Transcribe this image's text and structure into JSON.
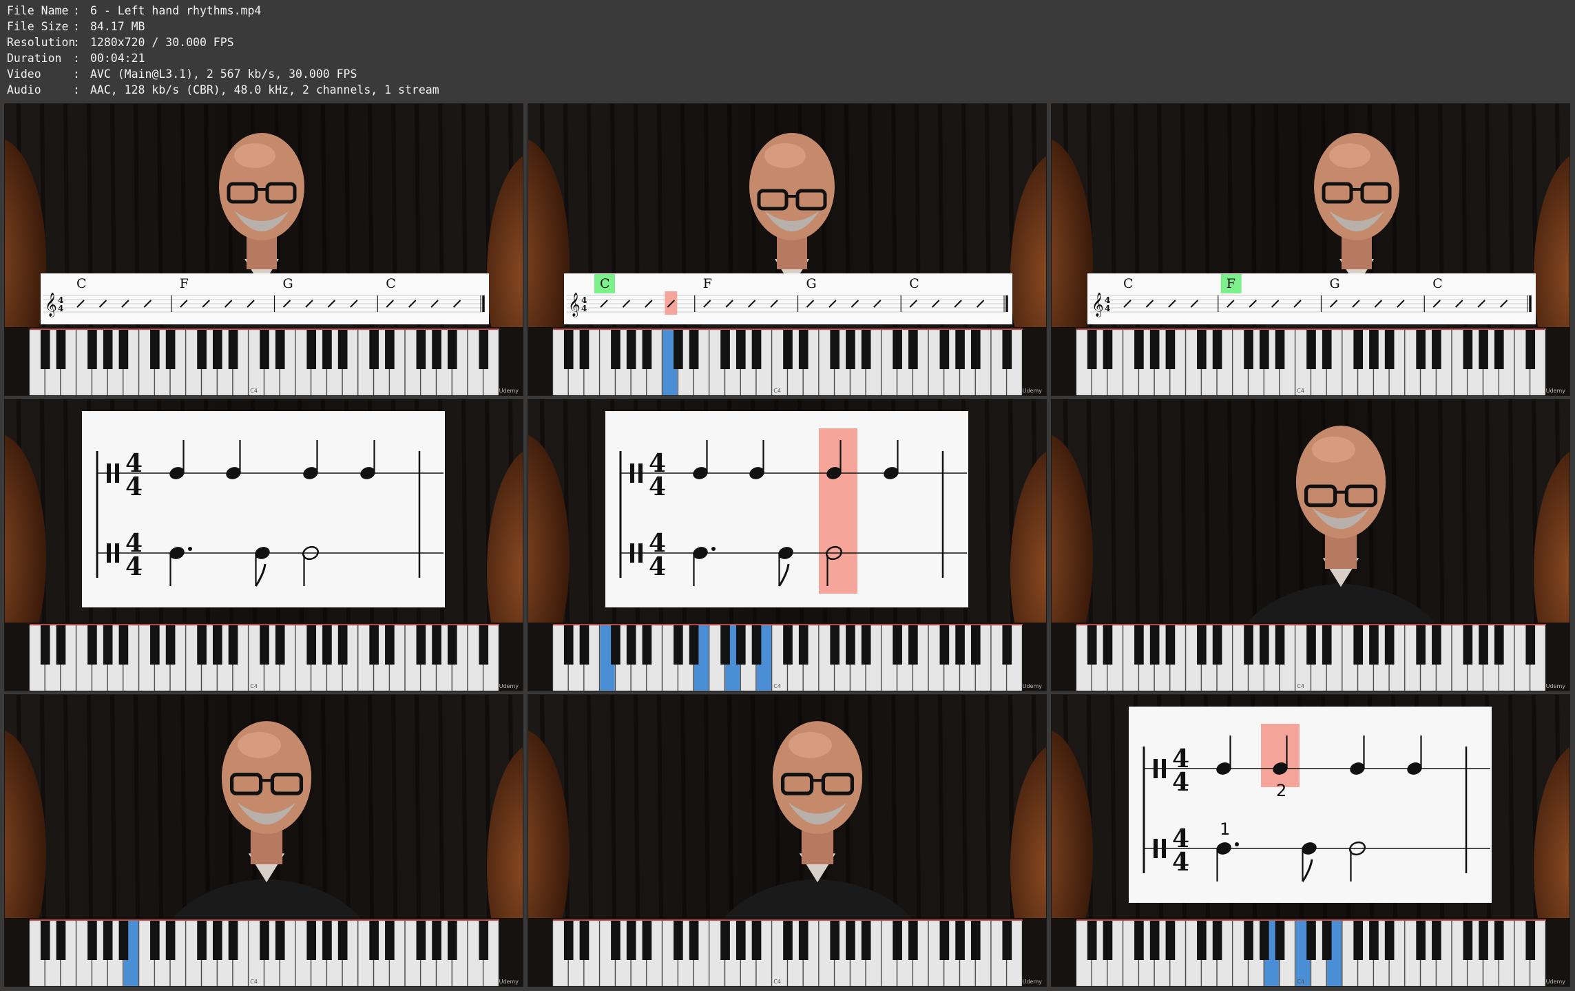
{
  "media_info": [
    {
      "label": "File Name",
      "value": "6 - Left hand rhythms.mp4"
    },
    {
      "label": "File Size",
      "value": "84.17 MB"
    },
    {
      "label": "Resolution",
      "value": "1280x720 / 30.000 FPS"
    },
    {
      "label": "Duration",
      "value": "00:04:21"
    },
    {
      "label": "Video",
      "value": "AVC (Main@L3.1), 2 567 kb/s, 30.000 FPS"
    },
    {
      "label": "Audio",
      "value": "AAC, 128 kb/s (CBR), 48.0 kHz, 2 channels, 1 stream"
    }
  ],
  "separator": ":",
  "keyboard": {
    "middle_c_label": "C4",
    "watermark": "Udemy"
  },
  "chord_chart": {
    "chords": [
      "C",
      "F",
      "G",
      "C"
    ],
    "time_signature": "4/4"
  },
  "rhythm_chart": {
    "time_signature": "4/4",
    "beat_labels": {
      "one": "1",
      "two": "2"
    }
  },
  "thumbnails": [
    {
      "id": "t1",
      "kind": "presenter-chords",
      "highlight_chord": -1,
      "highlight_slash": -1,
      "blue_keys": []
    },
    {
      "id": "t2",
      "kind": "presenter-chords",
      "highlight_chord": 0,
      "highlight_slash": 3,
      "blue_keys": [
        7
      ]
    },
    {
      "id": "t3",
      "kind": "presenter-chords",
      "highlight_chord": 1,
      "highlight_slash": -1,
      "blue_keys": []
    },
    {
      "id": "t4",
      "kind": "rhythm",
      "highlight": "none",
      "blue_keys": []
    },
    {
      "id": "t5",
      "kind": "rhythm",
      "highlight": "beat3",
      "blue_keys": [
        3,
        9,
        11,
        13
      ]
    },
    {
      "id": "t6",
      "kind": "presenter",
      "blue_keys": []
    },
    {
      "id": "t7",
      "kind": "presenter",
      "blue_keys": [
        6
      ]
    },
    {
      "id": "t8",
      "kind": "presenter",
      "blue_keys": []
    },
    {
      "id": "t9",
      "kind": "rhythm-numbered",
      "highlight": "beat2",
      "blue_keys": [
        12,
        14,
        16
      ]
    }
  ],
  "colors": {
    "green_highlight": "#7CF08A",
    "red_highlight": "#F6A59A",
    "blue_key": "#4A8FD6"
  }
}
